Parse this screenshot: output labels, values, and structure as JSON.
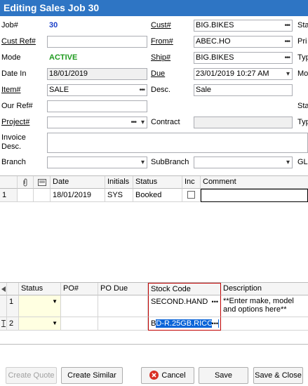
{
  "window": {
    "title": "Editing Sales Job 30"
  },
  "form": {
    "job_label": "Job#",
    "job_value": "30",
    "cust_ref_label": "Cust Ref#",
    "cust_ref_value": "",
    "mode_label": "Mode",
    "mode_value": "ACTIVE",
    "date_in_label": "Date In",
    "date_in_value": "18/01/2019",
    "item_label": "Item#",
    "item_value": "SALE",
    "our_ref_label": "Our Ref#",
    "our_ref_value": "",
    "project_label": "Project#",
    "project_value": "",
    "invoice_desc_label": "Invoice Desc.",
    "invoice_desc_value": "",
    "branch_label": "Branch",
    "branch_value": "",
    "cust_label": "Cust#",
    "cust_value": "BIG.BIKES",
    "from_label": "From#",
    "from_value": "ABEC.HO",
    "ship_label": "Ship#",
    "ship_value": "BIG.BIKES",
    "due_label": "Due",
    "due_value": "23/01/2019 10:27 AM",
    "desc_label": "Desc.",
    "desc_value": "Sale",
    "contract_label": "Contract",
    "contract_value": "",
    "subbranch_label": "SubBranch",
    "subbranch_value": "",
    "right_col_labels": [
      "Sta",
      "Pri",
      "Typ",
      "Mo",
      "Sta",
      "Typ",
      "GL"
    ]
  },
  "status_grid": {
    "headers": [
      "Date",
      "Initials",
      "Status",
      "Inc",
      "Comment"
    ],
    "rows": [
      {
        "num": "1",
        "date": "18/01/2019",
        "initials": "SYS",
        "status": "Booked",
        "inc": false,
        "comment": ""
      }
    ]
  },
  "stock_grid": {
    "headers": [
      "Status",
      "PO#",
      "PO Due",
      "Stock Code",
      "Description"
    ],
    "rows": [
      {
        "num": "1",
        "status": "",
        "po": "",
        "po_due": "",
        "stock_code": "SECOND.HAND",
        "description": "**Enter make, model and options here**"
      },
      {
        "num": "2",
        "status": "",
        "po": "",
        "po_due": "",
        "stock_code_prefix": "B",
        "stock_code_selected": "D-R.25GB.RICOH",
        "description": ""
      }
    ]
  },
  "buttons": {
    "create_quote": "Create Quote",
    "create_similar": "Create Similar",
    "cancel": "Cancel",
    "save": "Save",
    "save_close": "Save & Close"
  },
  "icons": {
    "ellipsis": "ellipsis-icon",
    "dropdown": "chevron-down-icon",
    "cancel": "cancel-x-icon",
    "attachment": "paperclip-icon",
    "note": "note-icon",
    "row_cursor": "text-cursor-icon"
  },
  "colors": {
    "titlebar": "#2e75c4",
    "job_number": "#1a3fc9",
    "mode_active": "#1f9b1f",
    "stock_code_highlight": "#c00000",
    "selection": "#0a64d8",
    "cancel_icon": "#d93025",
    "row_status_cell": "#ffffe1"
  }
}
